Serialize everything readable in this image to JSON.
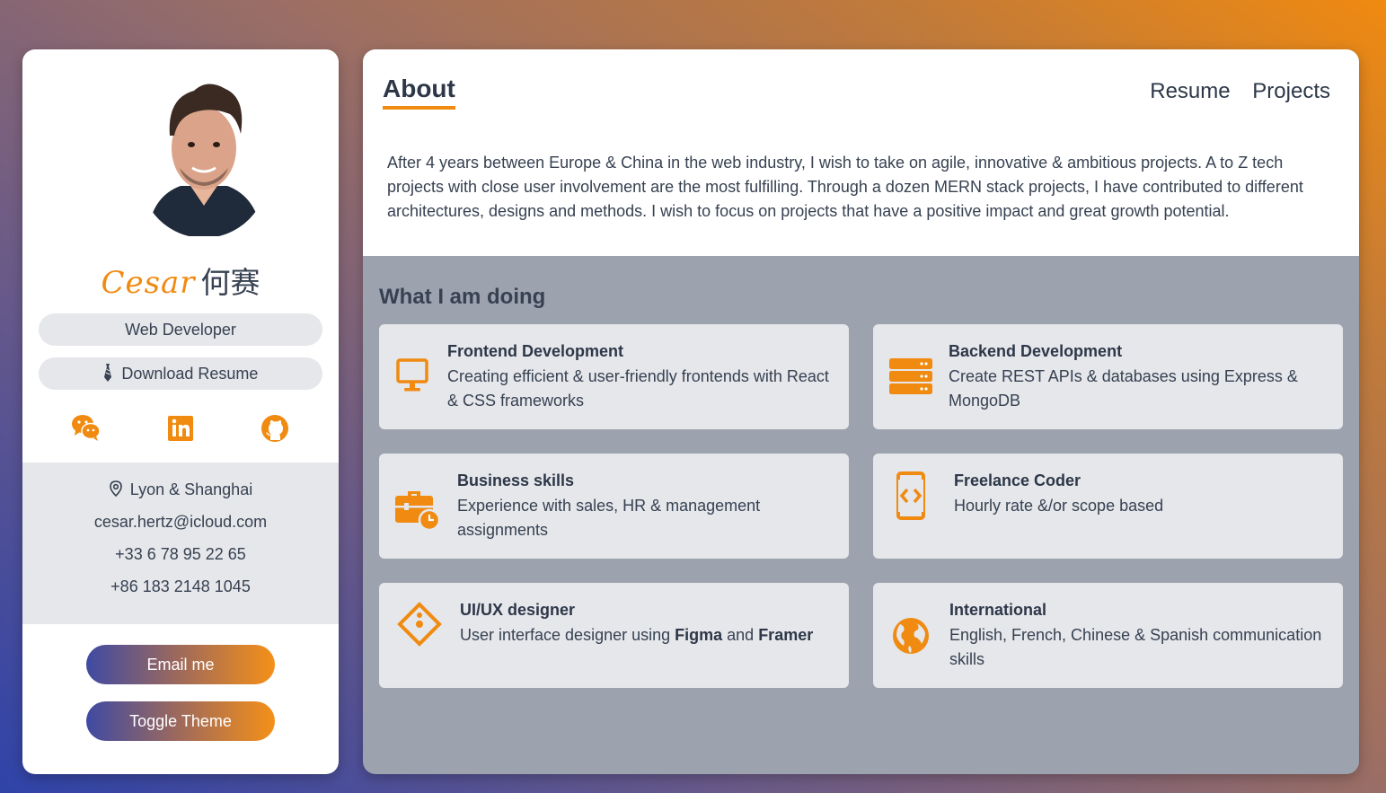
{
  "profile": {
    "name_latin": "Cesar",
    "name_chinese": "何赛",
    "role": "Web Developer",
    "download_label": "Download Resume",
    "location": "Lyon & Shanghai",
    "email": "cesar.hertz@icloud.com",
    "phone_fr": "+33 6 78 95 22 65",
    "phone_cn": "+86 183 2148 1045",
    "email_button": "Email me",
    "theme_button": "Toggle Theme"
  },
  "socials": [
    "wechat-icon",
    "linkedin-icon",
    "github-icon"
  ],
  "nav": {
    "active": "About",
    "links": [
      "Resume",
      "Projects"
    ]
  },
  "about": {
    "text": "After 4 years between Europe & China in the web industry, I wish to take on agile, innovative & ambitious projects. A to Z tech projects with close user involvement are the most fulfilling. Through a dozen MERN stack projects, I have contributed to different architectures, designs and methods. I wish to focus on projects that have a positive impact and great growth potential."
  },
  "doing": {
    "title": "What I am doing",
    "cards": [
      {
        "title": "Frontend Development",
        "desc": "Creating efficient & user-friendly frontends with React & CSS frameworks",
        "icon": "monitor-icon"
      },
      {
        "title": "Backend Development",
        "desc": "Create REST APIs & databases using Express & MongoDB",
        "icon": "server-icon"
      },
      {
        "title": "Business skills",
        "desc": "Experience with sales, HR & management assignments",
        "icon": "briefcase-clock-icon"
      },
      {
        "title": "Freelance Coder",
        "desc": "Hourly rate &/or scope based",
        "icon": "mobile-code-icon"
      },
      {
        "title": "UI/UX designer",
        "desc_pre": "User interface designer using ",
        "desc_b1": "Figma",
        "desc_mid": " and ",
        "desc_b2": "Framer",
        "icon": "design-diamond-icon"
      },
      {
        "title": "International",
        "desc": "English, French, Chinese & Spanish communication skills",
        "icon": "globe-icon"
      }
    ]
  },
  "colors": {
    "accent": "#f08a10",
    "text": "#374151",
    "panel_gray": "#9ca3af",
    "card_gray": "#e5e7eb"
  }
}
